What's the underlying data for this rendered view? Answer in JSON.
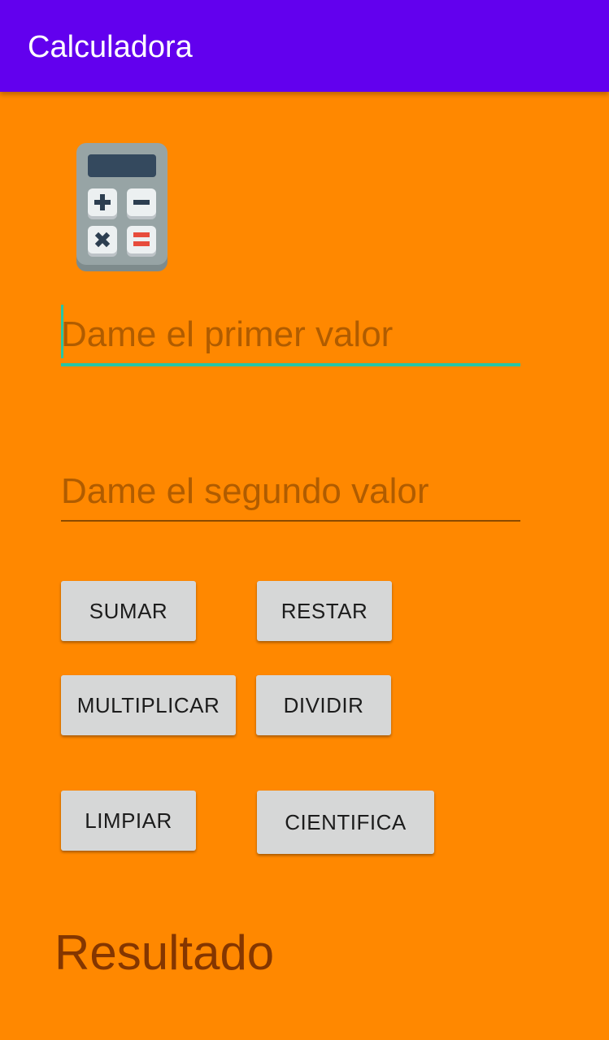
{
  "app_bar": {
    "title": "Calculadora",
    "color": "#6200EE"
  },
  "background_color": "#FF8800",
  "icon": {
    "name": "calculator-icon"
  },
  "inputs": {
    "first": {
      "value": "",
      "placeholder": "Dame el primer valor",
      "focused": true
    },
    "second": {
      "value": "",
      "placeholder": "Dame el segundo valor"
    }
  },
  "buttons": {
    "sumar": "SUMAR",
    "restar": "RESTAR",
    "multiplicar": "MULTIPLICAR",
    "dividir": "DIVIDIR",
    "limpiar": "LIMPIAR",
    "cientifica": "CIENTIFICA"
  },
  "result": {
    "label": "Resultado"
  }
}
